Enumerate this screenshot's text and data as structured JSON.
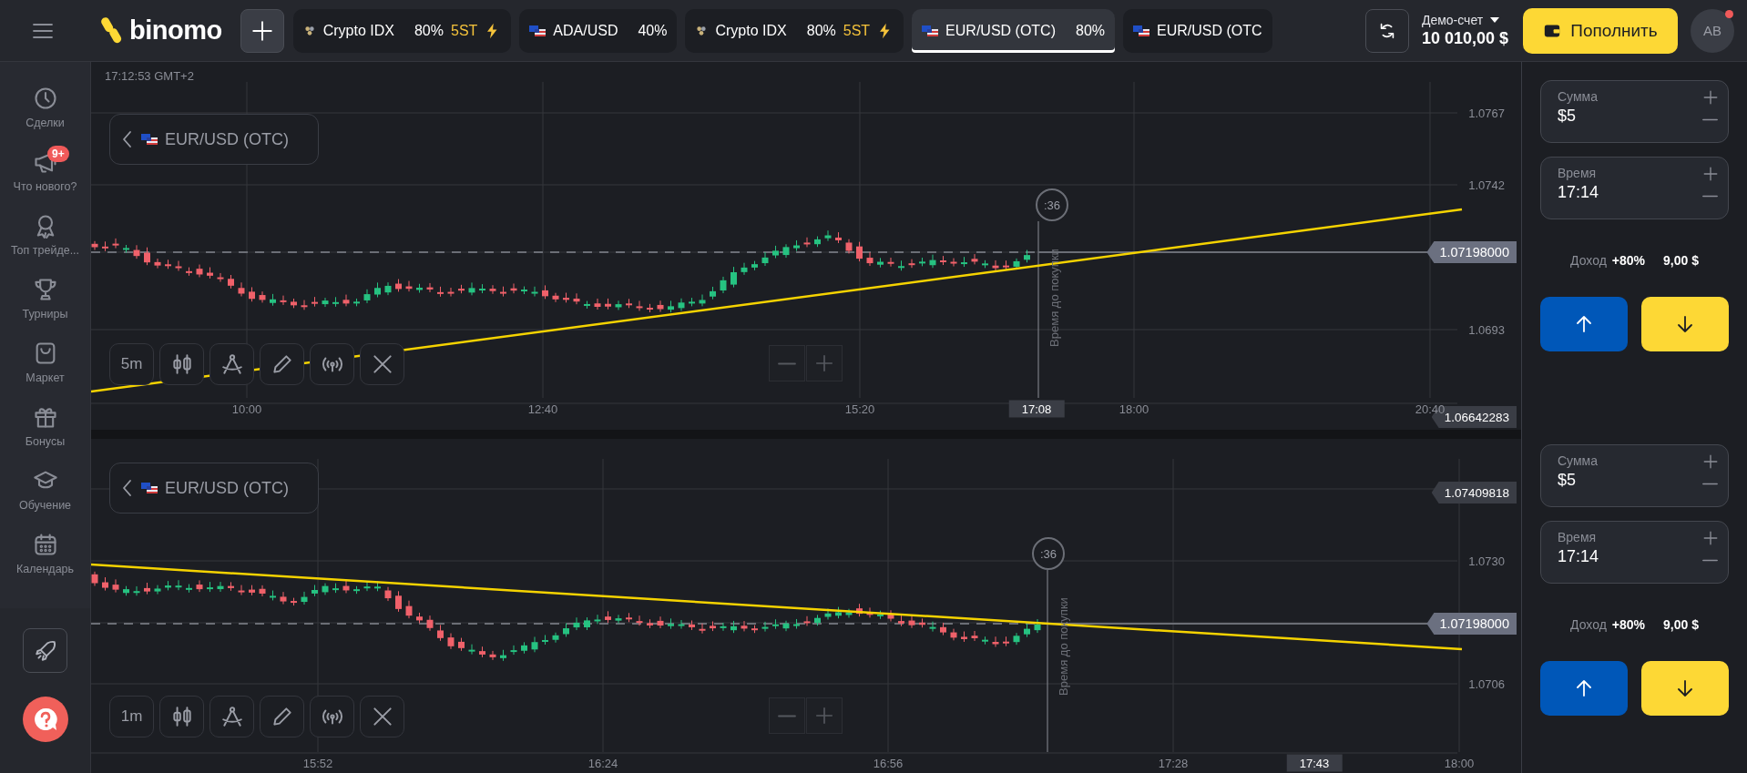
{
  "top_bar": {
    "logo": "binomo",
    "asset_tabs": [
      {
        "kind": "crypto",
        "name": "Crypto IDX",
        "payout": "80%",
        "badge": "5ST",
        "selected": false
      },
      {
        "kind": "forex",
        "name": "ADA/USD",
        "payout": "40%",
        "selected": false
      },
      {
        "kind": "crypto",
        "name": "Crypto IDX",
        "payout": "80%",
        "badge": "5ST",
        "selected": false
      },
      {
        "kind": "forex",
        "name": "EUR/USD (OTC)",
        "payout": "80%",
        "selected": true
      },
      {
        "kind": "forex",
        "name": "EUR/USD (OTC",
        "selected": false
      }
    ],
    "account": {
      "label": "Демо-счет",
      "balance": "10 010,00 $"
    },
    "deposit_button": "Пополнить",
    "avatar": "AB"
  },
  "sidebar": {
    "items": [
      {
        "kind": "clock",
        "label": "Сделки"
      },
      {
        "kind": "megaphone",
        "label": "Что нового?",
        "badge": "9+"
      },
      {
        "kind": "medal",
        "label": "Топ трейде..."
      },
      {
        "kind": "trophy",
        "label": "Турниры"
      },
      {
        "kind": "bag",
        "label": "Маркет"
      },
      {
        "kind": "gift",
        "label": "Бонусы"
      },
      {
        "kind": "cap",
        "label": "Обучение"
      },
      {
        "kind": "calendar",
        "label": "Календарь"
      }
    ]
  },
  "charts": [
    {
      "clock": "17:12:53 GMT+2",
      "asset": "EUR/USD (OTC)",
      "timeframe": "5m",
      "countdown": ":36",
      "countdown_caption": "Время до покупки",
      "price_labels": [
        "1.0767",
        "1.0742",
        "1.0693"
      ],
      "price_tags": [
        {
          "kind": "current",
          "value": "1.07198000"
        },
        {
          "kind": "marker",
          "value": "1.06642283"
        }
      ],
      "time_labels": [
        "10:00",
        "12:40",
        "15:20",
        "18:00",
        "20:40"
      ],
      "current_time": "17:08"
    },
    {
      "asset": "EUR/USD (OTC)",
      "timeframe": "1m",
      "countdown": ":36",
      "countdown_caption": "Время до покупки",
      "price_labels": [
        "1.0730",
        "1.0706"
      ],
      "price_tags": [
        {
          "kind": "marker",
          "value": "1.07409818"
        },
        {
          "kind": "current",
          "value": "1.07198000"
        }
      ],
      "time_labels": [
        "15:52",
        "16:24",
        "16:56",
        "17:28",
        "18:00"
      ],
      "current_time": "17:43"
    }
  ],
  "trade_panels": [
    {
      "amount_label": "Сумма",
      "amount": "$5",
      "time_label": "Время",
      "time": "17:14",
      "income_label": "Доход",
      "income_percent": "+80%",
      "income_value": "9,00 $"
    },
    {
      "amount_label": "Сумма",
      "amount": "$5",
      "time_label": "Время",
      "time": "17:14",
      "income_label": "Доход",
      "income_percent": "+80%",
      "income_value": "9,00 $"
    }
  ]
}
